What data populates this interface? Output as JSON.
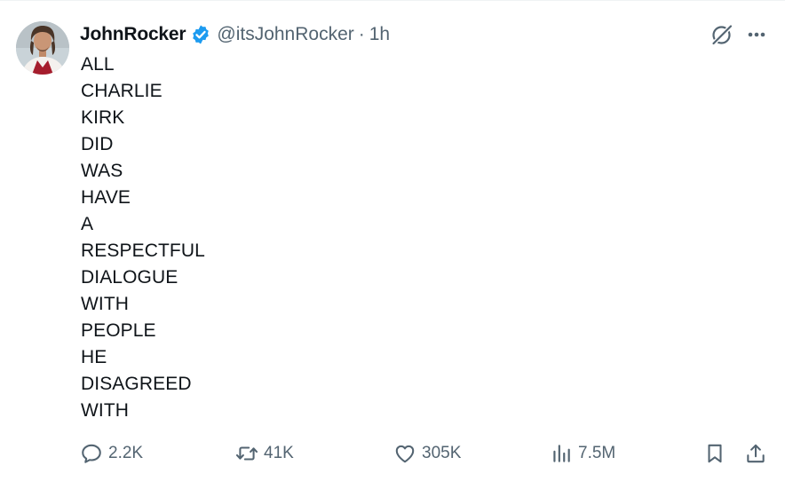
{
  "author": {
    "display_name": "JohnRocker",
    "handle": "@itsJohnRocker",
    "separator": "·",
    "time": "1h",
    "verified": true
  },
  "tweet_lines": [
    "ALL",
    "CHARLIE",
    "KIRK",
    "DID",
    "WAS",
    "HAVE",
    "A",
    "RESPECTFUL",
    "DIALOGUE",
    "WITH",
    "PEOPLE",
    "HE",
    "DISAGREED",
    "WITH"
  ],
  "actions": {
    "replies": "2.2K",
    "reposts": "41K",
    "likes": "305K",
    "views": "7.5M"
  },
  "icons": {
    "verified": "verified-badge-icon",
    "grok": "grok-icon",
    "more": "more-icon",
    "reply": "reply-icon",
    "repost": "repost-icon",
    "like": "heart-icon",
    "views": "views-icon",
    "bookmark": "bookmark-icon",
    "share": "share-icon"
  },
  "colors": {
    "text": "#0f1419",
    "secondary": "#536471",
    "verified": "#1d9bf0"
  }
}
